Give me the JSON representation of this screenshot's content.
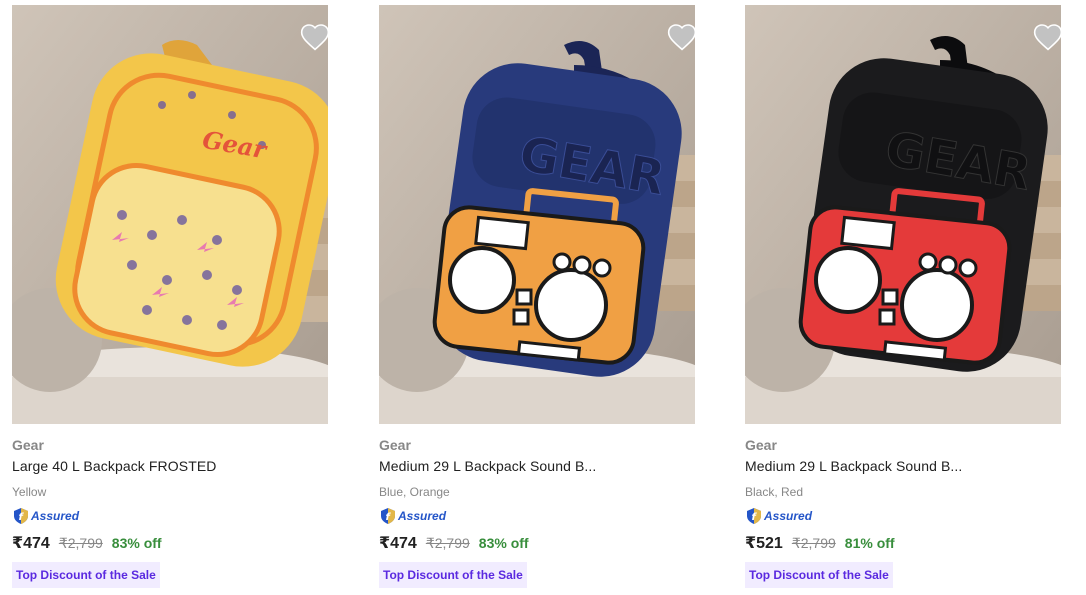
{
  "products": [
    {
      "brand": "Gear",
      "title": "Large 40 L Backpack FROSTED",
      "variant": "Yellow",
      "assured_label": "Assured",
      "price": "₹474",
      "mrp": "₹2,799",
      "discount": "83% off",
      "badge": "Top Discount of the Sale",
      "logo_text": "Gear",
      "colors": {
        "body": "#f3c64a",
        "trim": "#ef8a2e",
        "pocket": "#f7e08f"
      }
    },
    {
      "brand": "Gear",
      "title": "Medium 29 L Backpack Sound B...",
      "variant": "Blue, Orange",
      "assured_label": "Assured",
      "price": "₹474",
      "mrp": "₹2,799",
      "discount": "83% off",
      "badge": "Top Discount of the Sale",
      "logo_text": "GEAR",
      "colors": {
        "body": "#283a7c",
        "trim": "#1b2556",
        "pocket": "#f0a044"
      }
    },
    {
      "brand": "Gear",
      "title": "Medium 29 L Backpack Sound B...",
      "variant": "Black, Red",
      "assured_label": "Assured",
      "price": "₹521",
      "mrp": "₹2,799",
      "discount": "81% off",
      "badge": "Top Discount of the Sale",
      "logo_text": "GEAR",
      "colors": {
        "body": "#1b1b1d",
        "trim": "#0c0c0e",
        "pocket": "#e43a3a"
      }
    }
  ],
  "icons": {
    "wishlist": "heart-icon",
    "assured": "assured-shield-icon"
  }
}
